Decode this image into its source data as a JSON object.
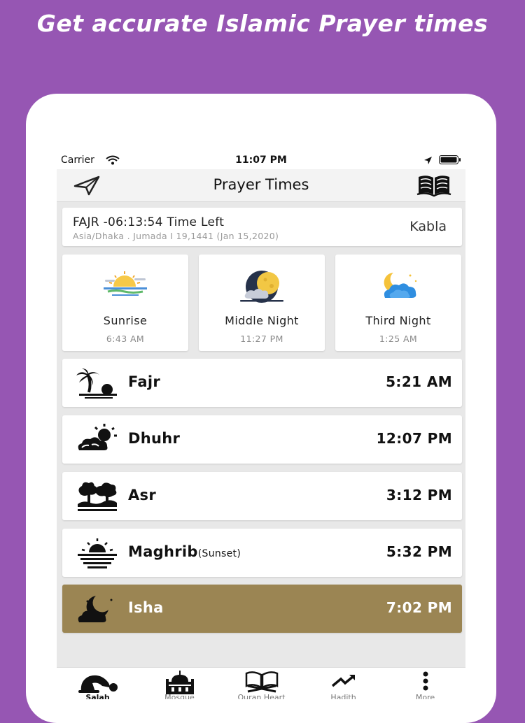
{
  "promo": {
    "headline": "Get accurate Islamic Prayer times"
  },
  "status_bar": {
    "carrier": "Carrier",
    "time": "11:07 PM",
    "icons": [
      "wifi-icon",
      "location-arrow-icon",
      "battery-icon"
    ]
  },
  "nav": {
    "title": "Prayer Times",
    "left_icon": "send-icon",
    "right_icon": "book-icon"
  },
  "next_prayer": {
    "title": "FAJR -06:13:54 Time Left",
    "subtitle": "Asia/Dhaka . Jumada I 19,1441 (Jan 15,2020)",
    "mode": "Kabla"
  },
  "tiles": [
    {
      "label": "Sunrise",
      "time": "6:43 AM",
      "icon": "sunrise-icon"
    },
    {
      "label": "Middle Night",
      "time": "11:27 PM",
      "icon": "moon-cloud-icon"
    },
    {
      "label": "Third Night",
      "time": "1:25 AM",
      "icon": "crescent-cloud-icon"
    }
  ],
  "prayers": [
    {
      "name": "Fajr",
      "note": "",
      "time": "5:21 AM",
      "icon": "palm-sunrise-icon",
      "active": false
    },
    {
      "name": "Dhuhr",
      "note": "",
      "time": "12:07 PM",
      "icon": "sun-cloud-icon",
      "active": false
    },
    {
      "name": "Asr",
      "note": "",
      "time": "3:12 PM",
      "icon": "tree-landscape-icon",
      "active": false
    },
    {
      "name": "Maghrib",
      "note": "(Sunset)",
      "time": "5:32 PM",
      "icon": "sunset-icon",
      "active": false
    },
    {
      "name": "Isha",
      "note": "",
      "time": "7:02 PM",
      "icon": "night-moon-icon",
      "active": true
    }
  ],
  "tabs": [
    {
      "label": "Salah",
      "icon": "prostration-icon",
      "active": true
    },
    {
      "label": "Mosque",
      "icon": "mosque-icon",
      "active": false
    },
    {
      "label": "Quran Heart",
      "icon": "quran-icon",
      "active": false
    },
    {
      "label": "Hadith",
      "icon": "trend-icon",
      "active": false
    },
    {
      "label": "More",
      "icon": "more-vertical-icon",
      "active": false
    }
  ],
  "colors": {
    "background": "#9656b3",
    "active_row": "#9b8553",
    "screen_bg": "#e8e8e8"
  }
}
